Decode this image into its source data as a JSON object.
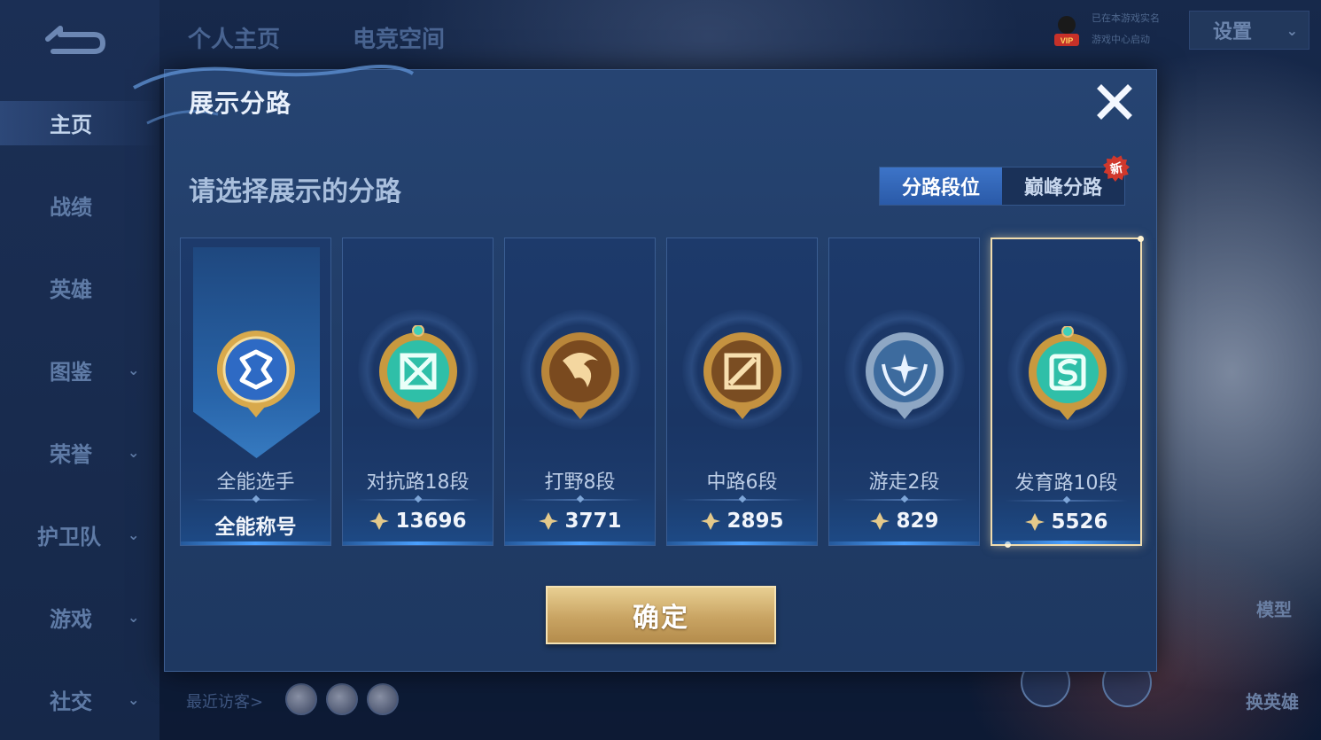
{
  "top_tabs": [
    "个人主页",
    "电竞空间"
  ],
  "sidebar": {
    "items": [
      {
        "label": "主页",
        "has_chevron": false,
        "active": true
      },
      {
        "label": "战绩",
        "has_chevron": false
      },
      {
        "label": "英雄",
        "has_chevron": false
      },
      {
        "label": "图鉴",
        "has_chevron": true
      },
      {
        "label": "荣誉",
        "has_chevron": true
      },
      {
        "label": "护卫队",
        "has_chevron": true
      },
      {
        "label": "游戏",
        "has_chevron": true
      },
      {
        "label": "社交",
        "has_chevron": true
      }
    ],
    "chevron": "⌄"
  },
  "header": {
    "vip_line1": "已在本游戏实名",
    "vip_line2": "游戏中心启动",
    "settings_label": "设置"
  },
  "footer": {
    "recent_visitors": "最近访客>"
  },
  "right_panel": {
    "model_label": "模型",
    "switch_hero_label": "换英雄"
  },
  "dialog": {
    "title": "展示分路",
    "subtitle": "请选择展示的分路",
    "tabs": [
      {
        "label": "分路段位",
        "active": true
      },
      {
        "label": "巅峰分路",
        "active": false,
        "badge": "新"
      }
    ],
    "cards": [
      {
        "name": "全能选手",
        "score": "全能称号",
        "emblem": "allround-emblem-icon",
        "selected": false
      },
      {
        "name": "对抗路18段",
        "score": "13696",
        "emblem": "clash-lane-emblem-icon",
        "selected": false
      },
      {
        "name": "打野8段",
        "score": "3771",
        "emblem": "jungle-emblem-icon",
        "selected": false
      },
      {
        "name": "中路6段",
        "score": "2895",
        "emblem": "mid-lane-emblem-icon",
        "selected": false
      },
      {
        "name": "游走2段",
        "score": "829",
        "emblem": "roam-emblem-icon",
        "selected": false
      },
      {
        "name": "发育路10段",
        "score": "5526",
        "emblem": "farm-lane-emblem-icon",
        "selected": true
      }
    ],
    "confirm_label": "确定"
  },
  "colors": {
    "accent_blue": "#2a5aa8",
    "gold": "#c9a463",
    "card_bg": "#1a3564",
    "selected_border": "#f0dcae"
  }
}
